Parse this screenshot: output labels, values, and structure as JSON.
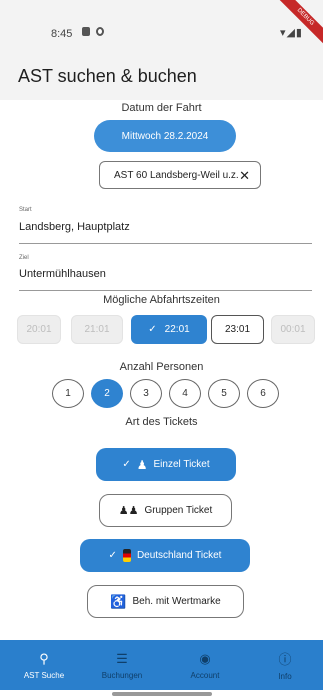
{
  "status": {
    "time": "8:45"
  },
  "appbar": {
    "title": "AST suchen & buchen"
  },
  "date_section": {
    "label": "Datum der Fahrt",
    "selected_date": "Mittwoch 28.2.2024"
  },
  "route_chip": {
    "label": "AST 60 Landsberg-Weil u.z."
  },
  "start": {
    "caption": "Start",
    "value": "Landsberg, Hauptplatz"
  },
  "ziel": {
    "caption": "Ziel",
    "value": "Untermühlhausen"
  },
  "departures": {
    "label": "Mögliche Abfahrtszeiten",
    "times": [
      "20:01",
      "21:01",
      "22:01",
      "23:01",
      "00:01"
    ],
    "selected": "22:01"
  },
  "persons": {
    "label": "Anzahl Personen",
    "options": [
      "1",
      "2",
      "3",
      "4",
      "5",
      "6"
    ],
    "selected": "2"
  },
  "tickets": {
    "label": "Art des Tickets",
    "einzel": "Einzel Ticket",
    "gruppen": "Gruppen Ticket",
    "deutschland": "Deutschland Ticket",
    "beh": "Beh. mit Wertmarke"
  },
  "nav": {
    "items": [
      "AST Suche",
      "Buchungen",
      "Account",
      "Info"
    ],
    "active": "AST Suche"
  },
  "colors": {
    "primary": "#2f83d0",
    "nav_bg": "#2a7fcc",
    "debug": "#c62828"
  }
}
